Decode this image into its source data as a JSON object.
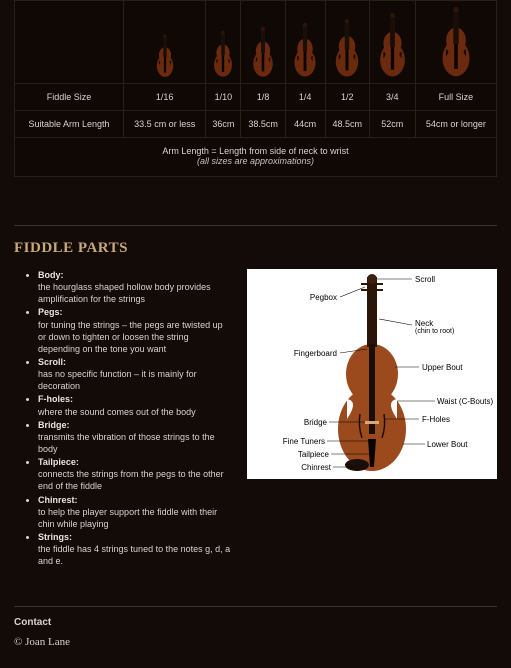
{
  "table": {
    "sizeLabel": "Fiddle Size",
    "armLabel": "Suitable Arm Length",
    "sizes": [
      "1/16",
      "1/10",
      "1/8",
      "1/4",
      "1/2",
      "3/4",
      "Full Size"
    ],
    "arms": [
      "33.5 cm or less",
      "36cm",
      "38.5cm",
      "44cm",
      "48.5cm",
      "52cm",
      "54cm or longer"
    ],
    "note1": "Arm Length = Length from side of neck to wrist",
    "note2": "(all sizes are approximations)"
  },
  "partsTitle": "Fiddle Parts",
  "parts": [
    {
      "name": "Body:",
      "desc": "the hourglass shaped hollow body provides amplification for the strings"
    },
    {
      "name": "Pegs:",
      "desc": "for tuning the strings – the pegs are twisted up or down to tighten or loosen the string depending on the tone you want"
    },
    {
      "name": "Scroll:",
      "desc": "has no specific function – it is mainly for decoration"
    },
    {
      "name": "F-holes:",
      "desc": "where the sound comes out of the body"
    },
    {
      "name": "Bridge:",
      "desc": "transmits the vibration of those strings to the body"
    },
    {
      "name": "Tailpiece:",
      "desc": "connects the strings from the pegs to the other end of the fiddle"
    },
    {
      "name": "Chinrest:",
      "desc": "to help the player support the fiddle with their chin while playing"
    },
    {
      "name": "Strings:",
      "desc": "the fiddle has 4 strings tuned to the notes g, d, a and e."
    }
  ],
  "diagram": {
    "scroll": "Scroll",
    "pegbox": "Pegbox",
    "neck": "Neck",
    "necknote": "(chin to root)",
    "fingerboard": "Fingerboard",
    "upperbout": "Upper Bout",
    "waist": "Waist (C-Bouts)",
    "fholes": "F-Holes",
    "bridge": "Bridge",
    "lowerbout": "Lower Bout",
    "finetuners": "Fine Tuners",
    "tailpiece": "Tailpiece",
    "chinrest": "Chinrest"
  },
  "contact": "Contact",
  "copyright": "© Joan Lane"
}
